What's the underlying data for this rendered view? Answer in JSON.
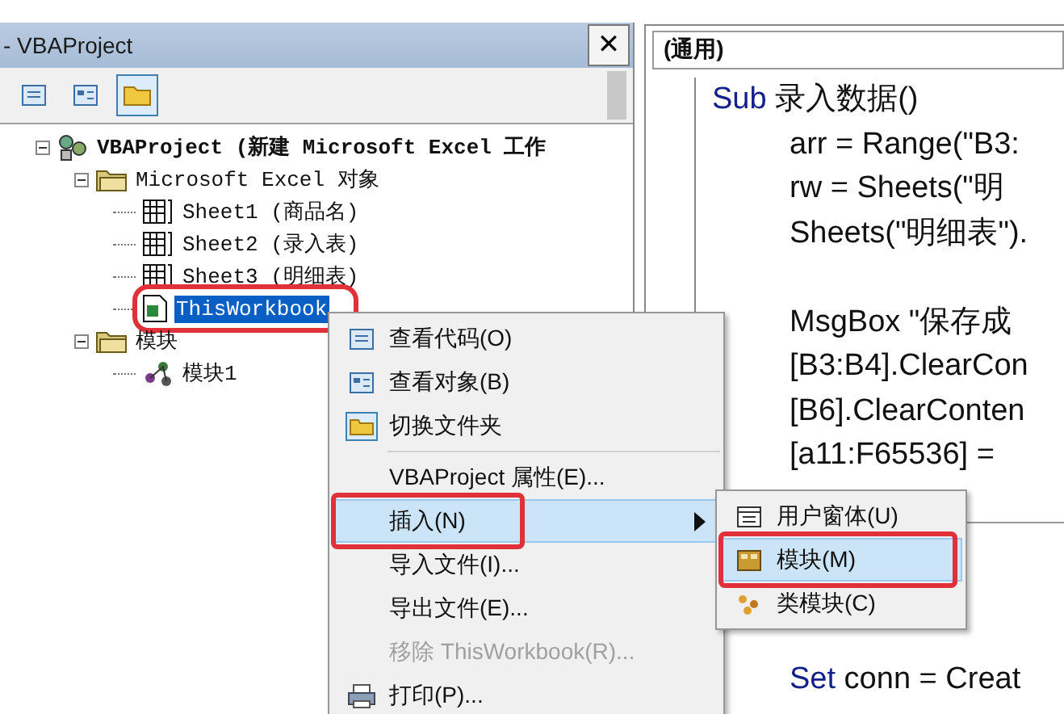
{
  "explorer": {
    "title": "- VBAProject",
    "close": "✕",
    "toolbar": [
      {
        "kind": "view-code",
        "selected": false
      },
      {
        "kind": "view-object",
        "selected": false
      },
      {
        "kind": "toggle-folders",
        "selected": true
      }
    ],
    "tree": [
      {
        "label": "VBAProject (新建 Microsoft Excel 工作",
        "kind": "project",
        "bold": true,
        "expanded": true,
        "selected": false,
        "annotated": false,
        "children": [
          {
            "label": "Microsoft Excel 对象",
            "kind": "folder",
            "expanded": true,
            "selected": false,
            "annotated": false,
            "children": [
              {
                "label": "Sheet1 (商品名)",
                "kind": "sheet",
                "selected": false,
                "annotated": false
              },
              {
                "label": "Sheet2 (录入表)",
                "kind": "sheet",
                "selected": false,
                "annotated": false
              },
              {
                "label": "Sheet3 (明细表)",
                "kind": "sheet",
                "selected": false,
                "annotated": false
              },
              {
                "label": "ThisWorkbook",
                "kind": "workbook",
                "selected": true,
                "annotated": true
              }
            ]
          },
          {
            "label": "模块",
            "kind": "folder",
            "expanded": true,
            "selected": false,
            "annotated": false,
            "children": [
              {
                "label": "模块1",
                "kind": "module",
                "selected": false,
                "annotated": false
              }
            ]
          }
        ]
      }
    ]
  },
  "code": {
    "object_box": "(通用)",
    "lines": [
      {
        "kind": "code",
        "keyword": "Sub",
        "text": "录入数据()",
        "indented": false
      },
      {
        "kind": "code",
        "text": "arr = Range(\"B3:",
        "indented": true
      },
      {
        "kind": "code",
        "text": "rw = Sheets(\"明",
        "indented": true
      },
      {
        "kind": "code",
        "text": "Sheets(\"明细表\").",
        "indented": true
      },
      {
        "kind": "blank"
      },
      {
        "kind": "code",
        "text": "MsgBox \"保存成",
        "indented": true
      },
      {
        "kind": "code",
        "text": "[B3:B4].ClearCon",
        "indented": true
      },
      {
        "kind": "code",
        "text": "[B6].ClearConten",
        "indented": true
      },
      {
        "kind": "code",
        "text": " [a11:F65536] =",
        "indented": true
      },
      {
        "kind": "blank"
      },
      {
        "kind": "separator"
      },
      {
        "kind": "blank"
      },
      {
        "kind": "blank"
      },
      {
        "kind": "blank"
      },
      {
        "kind": "code",
        "keyword": "Set",
        "text": " conn = Creat",
        "indented": true
      }
    ]
  },
  "context_menu": {
    "items": [
      {
        "kind": "view-code",
        "label": "查看代码(O)",
        "selected": false,
        "disabled": false,
        "annotated": false,
        "submenu": false
      },
      {
        "kind": "view-object",
        "label": "查看对象(B)",
        "selected": false,
        "disabled": false,
        "annotated": false,
        "submenu": false
      },
      {
        "kind": "toggle-folders",
        "label": "切换文件夹",
        "selected": false,
        "disabled": false,
        "annotated": false,
        "submenu": false
      },
      {
        "kind": "separator"
      },
      {
        "kind": "item",
        "label": "VBAProject 属性(E)...",
        "selected": false,
        "disabled": false,
        "annotated": false,
        "submenu": false
      },
      {
        "kind": "item",
        "label": "插入(N)",
        "selected": true,
        "disabled": false,
        "annotated": true,
        "submenu": true
      },
      {
        "kind": "item",
        "label": "导入文件(I)...",
        "selected": false,
        "disabled": false,
        "annotated": false,
        "submenu": false
      },
      {
        "kind": "item",
        "label": "导出文件(E)...",
        "selected": false,
        "disabled": false,
        "annotated": false,
        "submenu": false
      },
      {
        "kind": "item",
        "label": "移除 ThisWorkbook(R)...",
        "selected": false,
        "disabled": true,
        "annotated": false,
        "submenu": false
      },
      {
        "kind": "print",
        "label": "打印(P)...",
        "selected": false,
        "disabled": false,
        "annotated": false,
        "submenu": false
      }
    ]
  },
  "submenu": {
    "items": [
      {
        "kind": "userform",
        "label": "用户窗体(U)",
        "selected": false,
        "disabled": false,
        "annotated": false
      },
      {
        "kind": "module",
        "label": "模块(M)",
        "selected": true,
        "disabled": false,
        "annotated": true
      },
      {
        "kind": "class",
        "label": "类模块(C)",
        "selected": false,
        "disabled": false,
        "annotated": false
      }
    ]
  }
}
